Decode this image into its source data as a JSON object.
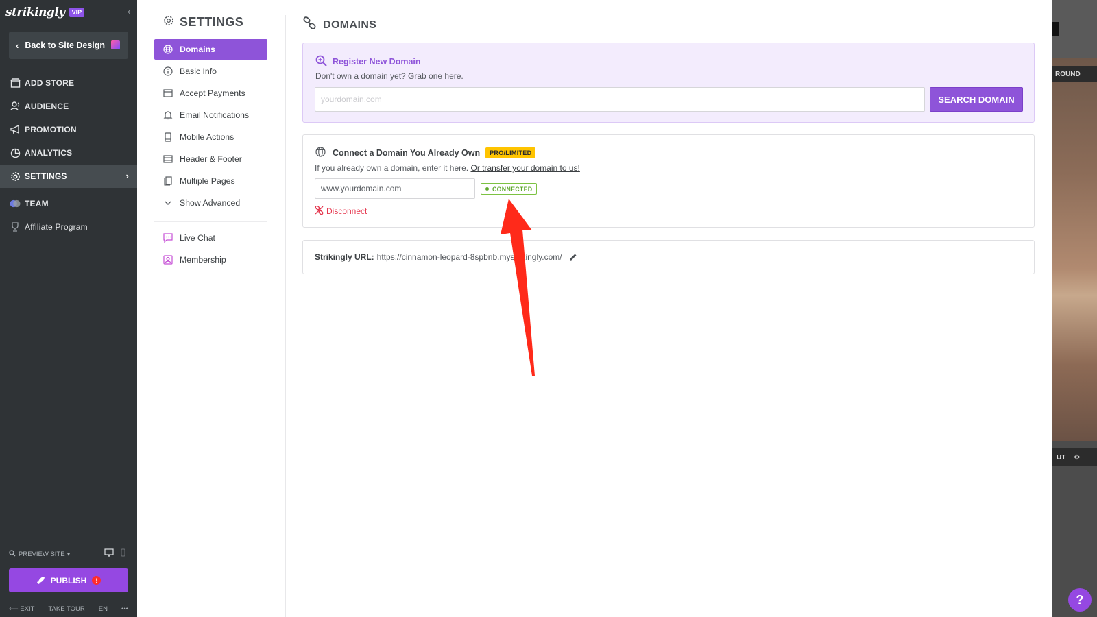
{
  "brand": {
    "logo": "strikingly",
    "badge": "VIP"
  },
  "sidebar": {
    "back_label": "Back to Site Design",
    "items": [
      {
        "label": "ADD STORE",
        "icon": "store-icon"
      },
      {
        "label": "AUDIENCE",
        "icon": "audience-icon"
      },
      {
        "label": "PROMOTION",
        "icon": "megaphone-icon"
      },
      {
        "label": "ANALYTICS",
        "icon": "analytics-icon"
      },
      {
        "label": "SETTINGS",
        "icon": "gear-icon",
        "active": true
      },
      {
        "label": "TEAM",
        "icon": "team-icon"
      },
      {
        "label": "Affiliate Program",
        "icon": "trophy-icon"
      }
    ],
    "preview_label": "PREVIEW SITE",
    "publish_label": "PUBLISH",
    "publish_warning": "!",
    "bottom": {
      "exit": "EXIT",
      "tour": "TAKE TOUR",
      "lang": "EN",
      "more": "•••"
    }
  },
  "settings_nav": {
    "title": "SETTINGS",
    "items": [
      {
        "label": "Domains",
        "icon": "globe-icon",
        "active": true
      },
      {
        "label": "Basic Info",
        "icon": "info-icon"
      },
      {
        "label": "Accept Payments",
        "icon": "card-icon"
      },
      {
        "label": "Email Notifications",
        "icon": "bell-icon"
      },
      {
        "label": "Mobile Actions",
        "icon": "mobile-icon"
      },
      {
        "label": "Header & Footer",
        "icon": "layout-icon"
      },
      {
        "label": "Multiple Pages",
        "icon": "pages-icon"
      },
      {
        "label": "Show Advanced",
        "icon": "chevron-down-icon"
      }
    ],
    "extras": [
      {
        "label": "Live Chat",
        "icon": "chat-icon"
      },
      {
        "label": "Membership",
        "icon": "membership-icon"
      }
    ]
  },
  "main": {
    "title": "DOMAINS",
    "register": {
      "heading": "Register New Domain",
      "subtitle": "Don't own a domain yet? Grab one here.",
      "placeholder": "yourdomain.com",
      "button": "SEARCH DOMAIN"
    },
    "connect": {
      "heading": "Connect a Domain You Already Own",
      "badge": "PRO/LIMITED",
      "subtitle": "If you already own a domain, enter it here.",
      "transfer_link": "Or transfer your domain to us!",
      "domain_value": "www.yourdomain.com",
      "status": "CONNECTED",
      "disconnect": "Disconnect"
    },
    "url": {
      "label": "Strikingly URL:",
      "value": "https://cinnamon-leopard-8spbnb.mystrikingly.com/"
    }
  },
  "preview": {
    "round_text": "ROUND",
    "out_text": "UT"
  },
  "help": "?",
  "colors": {
    "accent": "#8e54d9",
    "sidebar_bg": "#2f3336",
    "connected": "#5fa82e",
    "pro_badge": "#ffc400",
    "disconnect": "#e5384f",
    "arrow": "#ff2a1a"
  }
}
